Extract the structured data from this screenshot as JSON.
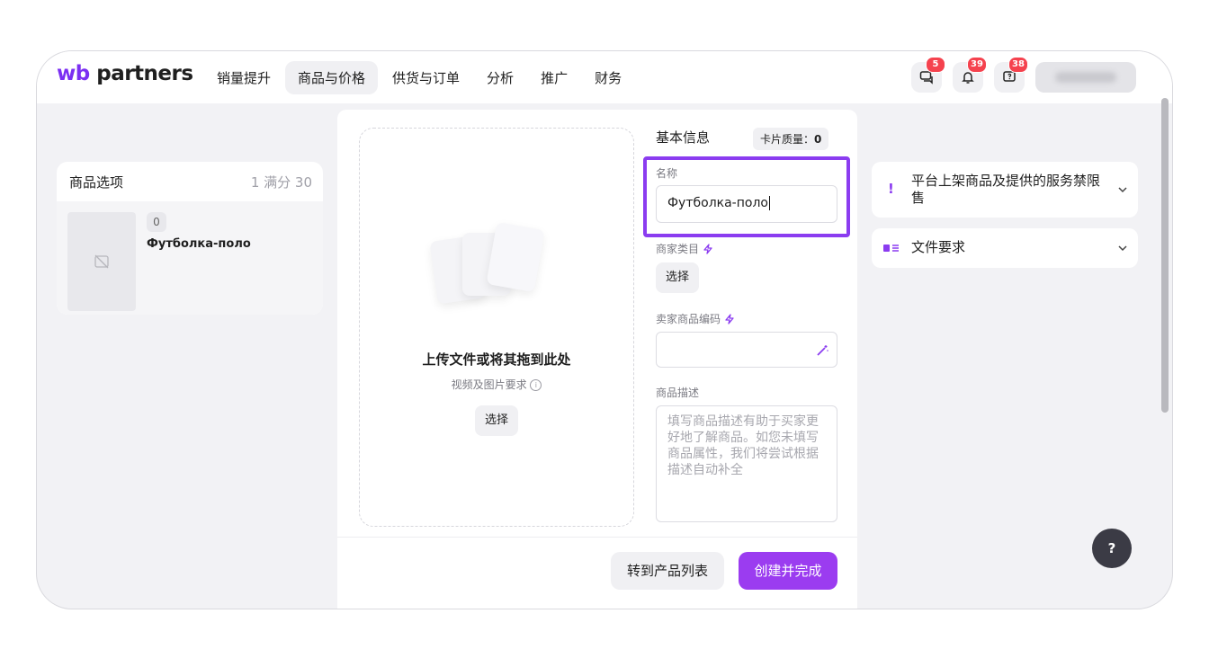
{
  "header": {
    "logo_wb": "wb",
    "logo_partners": "partners",
    "nav": [
      "销量提升",
      "商品与价格",
      "供货与订单",
      "分析",
      "推广",
      "财务"
    ],
    "active_nav": "商品与价格",
    "badges": {
      "chat": "5",
      "notifications": "39",
      "support": "38"
    }
  },
  "left": {
    "title": "商品选项",
    "count": "1 满分 30",
    "variant_badge": "0",
    "variant_name": "Футболка-поло"
  },
  "upload": {
    "title": "上传文件或将其拖到此处",
    "subtitle": "视频及图片要求",
    "select_label": "选择"
  },
  "form": {
    "title": "基本信息",
    "quality_label": "卡片质量：",
    "quality_value": "0",
    "name_label": "名称",
    "name_value": "Футболка-поло",
    "category_label": "商家类目",
    "category_button": "选择",
    "sku_label": "卖家商品编码",
    "sku_value": "",
    "description_label": "商品描述",
    "description_placeholder": "填写商品描述有助于买家更好地了解商品。如您未填写商品属性，我们将尝试根据描述自动补全"
  },
  "footer": {
    "secondary_button": "转到产品列表",
    "primary_button": "创建并完成"
  },
  "right": {
    "restrictions_title": "平台上架商品及提供的服务禁限售",
    "restrictions_icon": "!",
    "file_requirements_title": "文件要求"
  },
  "help_label": "?",
  "colors": {
    "accent": "#9b3cf0",
    "highlight_border": "#8b3cf0",
    "badge": "#f5424e"
  }
}
